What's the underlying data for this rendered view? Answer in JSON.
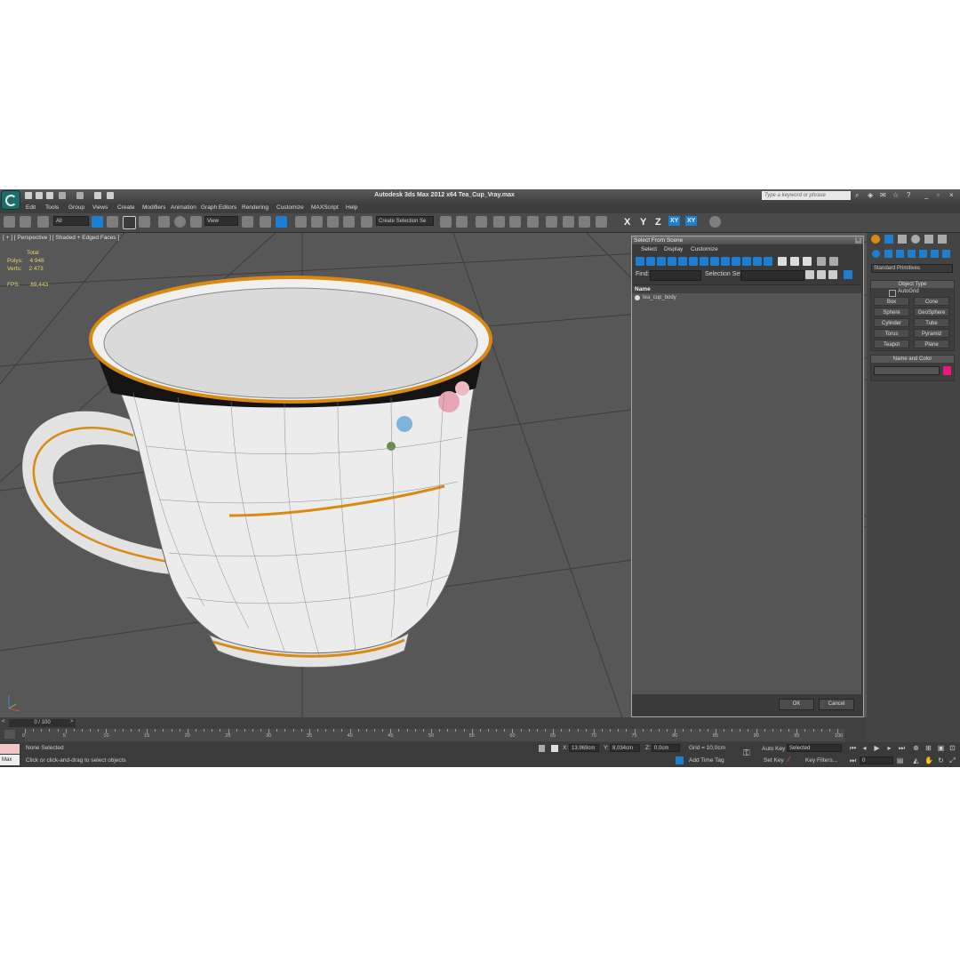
{
  "window": {
    "title": "Autodesk 3ds Max  2012 x64    Tea_Cup_Vray.max",
    "search_placeholder": "Type a keyword or phrase"
  },
  "menu": [
    "Edit",
    "Tools",
    "Group",
    "Views",
    "Create",
    "Modifiers",
    "Animation",
    "Graph Editors",
    "Rendering",
    "Customize",
    "MAXScript",
    "Help"
  ],
  "toolbar": {
    "filter_value": "All",
    "refcoord_value": "View",
    "selection_set_placeholder": "Create Selection Se",
    "axis_x": "X",
    "axis_y": "Y",
    "axis_z": "Z",
    "plane_xy": "XY",
    "plane_xy2": "XY"
  },
  "viewport": {
    "label": "[ + ] [ Perspective ] [ Shaded + Edged Faces ]",
    "stats": {
      "total_label": "Total",
      "polys_label": "Polys:",
      "polys_value": "4 946",
      "verts_label": "Verts:",
      "verts_value": "2 473",
      "fps_label": "FPS:",
      "fps_value": "89,443"
    }
  },
  "dialog": {
    "title": "Select From Scene",
    "close": "x",
    "menu": [
      "Select",
      "Display",
      "Customize"
    ],
    "find_label": "Find:",
    "selection_set_label": "Selection Set:",
    "list_header": "Name",
    "items": [
      "tea_cup_body"
    ],
    "ok": "OK",
    "cancel": "Cancel"
  },
  "command_panel": {
    "category": "Standard Primitives",
    "object_type_header": "Object Type",
    "autogrid": "AutoGrid",
    "buttons": [
      "Box",
      "Cone",
      "Sphere",
      "GeoSphere",
      "Cylinder",
      "Tube",
      "Torus",
      "Pyramid",
      "Teapot",
      "Plane"
    ],
    "name_color_header": "Name and Color",
    "color": "#e8197a"
  },
  "timeline": {
    "slider_text": "0 / 100",
    "ticks": [
      "0",
      "5",
      "10",
      "15",
      "20",
      "25",
      "30",
      "35",
      "40",
      "45",
      "50",
      "55",
      "60",
      "65",
      "70",
      "75",
      "80",
      "85",
      "90",
      "95",
      "100"
    ]
  },
  "status": {
    "maxscript_mini": "Max",
    "selection_status": "None Selected",
    "prompt": "Click or click-and-drag to select objects",
    "x_label": "X:",
    "x_value": "13,969cm",
    "y_label": "Y:",
    "y_value": "8,034cm",
    "z_label": "Z:",
    "z_value": "0,0cm",
    "grid": "Grid = 10,0cm",
    "add_time_tag": "Add Time Tag",
    "auto_key": "Auto Key",
    "auto_key_value": "Selected",
    "set_key": "Set Key",
    "key_filters": "Key Filters...",
    "frame_value": "0"
  },
  "colors": {
    "gold": "#d98a12",
    "band": "#141414",
    "accent": "#1d7fd2"
  }
}
